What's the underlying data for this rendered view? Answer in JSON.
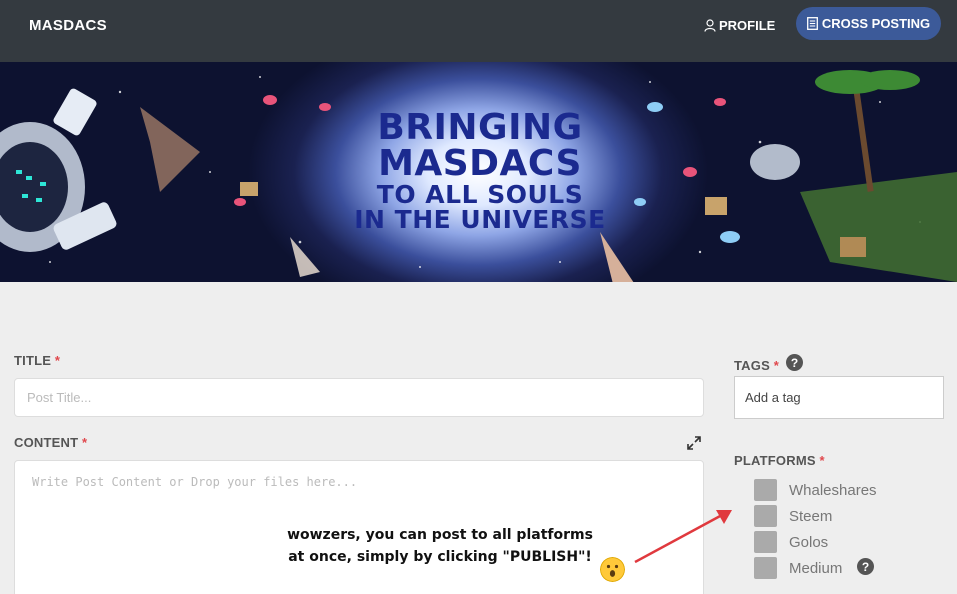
{
  "navbar": {
    "brand": "MASDACS",
    "profile_label": "PROFILE",
    "cross_posting_label": "CROSS POSTING"
  },
  "banner": {
    "line1": "BRINGING",
    "line2": "MASDACS",
    "line3": "TO ALL SOULS",
    "line4": "IN THE UNIVERSE"
  },
  "form": {
    "title_label": "TITLE",
    "title_placeholder": "Post Title...",
    "content_label": "CONTENT",
    "content_placeholder": "Write Post Content or Drop your files here...",
    "required_marker": "*"
  },
  "tags": {
    "label": "TAGS",
    "placeholder": "Add a tag",
    "help": "?"
  },
  "platforms": {
    "label": "PLATFORMS",
    "items": [
      {
        "label": "Whaleshares"
      },
      {
        "label": "Steem"
      },
      {
        "label": "Golos"
      },
      {
        "label": "Medium"
      }
    ],
    "help": "?"
  },
  "annotation": {
    "line1": "wowzers, you can post to all platforms",
    "line2": "at once, simply by clicking \"PUBLISH\"!"
  },
  "colors": {
    "navbar_bg": "#343a40",
    "accent_button": "#3c5a99",
    "required": "#e0474c",
    "arrow": "#e0393e"
  }
}
